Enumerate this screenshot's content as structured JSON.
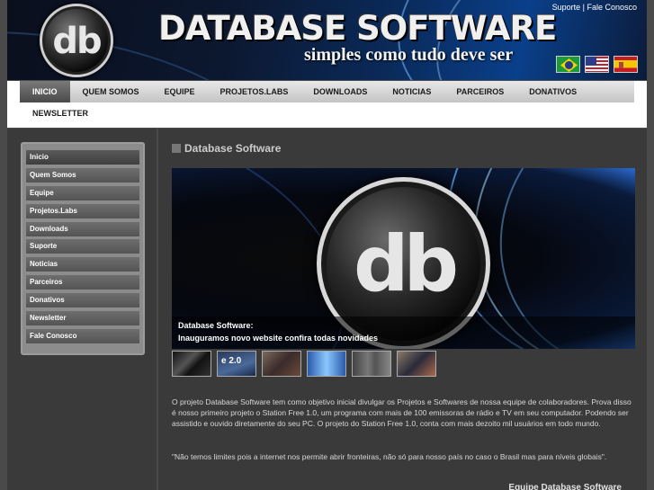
{
  "header": {
    "logo_text": "db",
    "site_title": "DATABASE SOFTWARE",
    "tagline": "simples como tudo deve ser",
    "top_links": {
      "suporte": "Suporte",
      "separator": "|",
      "fale_conosco": "Fale Conosco"
    },
    "flags": [
      {
        "name": "brazil-flag-icon"
      },
      {
        "name": "usa-flag-icon"
      },
      {
        "name": "spain-flag-icon"
      }
    ]
  },
  "nav": {
    "items": [
      {
        "label": "INICIO",
        "active": true
      },
      {
        "label": "QUEM SOMOS"
      },
      {
        "label": "EQUIPE"
      },
      {
        "label": "PROJETOS.LABS"
      },
      {
        "label": "DOWNLOADS"
      },
      {
        "label": "NOTICIAS"
      },
      {
        "label": "PARCEIROS"
      },
      {
        "label": "DONATIVOS"
      }
    ],
    "newsletter": "NEWSLETTER"
  },
  "sidebar": {
    "items": [
      {
        "label": "Inicio"
      },
      {
        "label": "Quem Somos"
      },
      {
        "label": "Equipe"
      },
      {
        "label": "Projetos.Labs"
      },
      {
        "label": "Downloads"
      },
      {
        "label": "Suporte"
      },
      {
        "label": "Noticias"
      },
      {
        "label": "Parceiros"
      },
      {
        "label": "Donativos"
      },
      {
        "label": "Newsletter"
      },
      {
        "label": "Fale Conosco"
      }
    ]
  },
  "main": {
    "section_title": "Database Software",
    "banner": {
      "logo_text": "db",
      "caption_title": "Database Software:",
      "caption_text": "Inauguramos novo website confira todas novidades"
    },
    "thumbs": [
      {
        "label": ""
      },
      {
        "label": "e 2.0"
      },
      {
        "label": ""
      },
      {
        "label": ""
      },
      {
        "label": ""
      },
      {
        "label": ""
      }
    ],
    "paragraph": "O projeto Database Software tem como objetivo inicial divulgar os Projetos e Softwares de nossa equipe de colaboradores. Prova disso é nosso primeiro projeto o Station Free 1.0, um programa com mais de 100 emissoras de rádio e TV em seu computador. Podendo ser assistido e ouvido diretamente do seu PC. O projeto do Station Free 1.0, conta com mais dezoito mil usuários em todo mundo.",
    "quote": "\"Não temos limites pois a internet nos permite abrir fronteiras, não só para nosso país no caso o Brasil mas para níveis globais\".",
    "signature": "Equipe Database Software"
  }
}
